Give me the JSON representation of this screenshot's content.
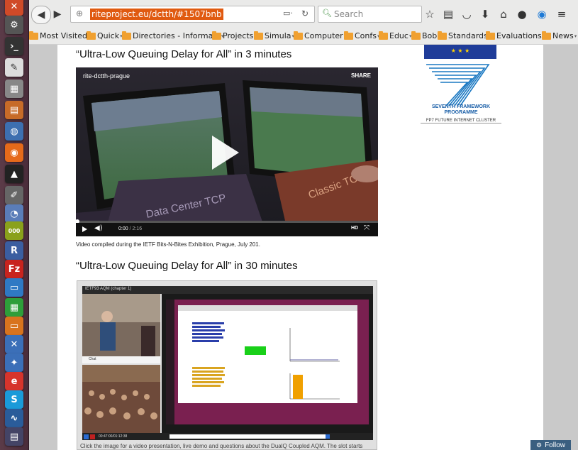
{
  "browser": {
    "url": "riteproject.eu/dctth/#1507bnb",
    "search_placeholder": "Search",
    "bookmarks": [
      {
        "label": "Most Visited",
        "arrow": "▾"
      },
      {
        "label": "Quick",
        "arrow": "▾"
      },
      {
        "label": "Directories - Informa...",
        "arrow": "▾"
      },
      {
        "label": "Projects",
        "arrow": "▾"
      },
      {
        "label": "Simula",
        "arrow": "▾"
      },
      {
        "label": "Computer",
        "arrow": "▾"
      },
      {
        "label": "Confs",
        "arrow": "▾"
      },
      {
        "label": "Educ",
        "arrow": "▾"
      },
      {
        "label": "Bob",
        "arrow": "▾"
      },
      {
        "label": "Standards",
        "arrow": "▾"
      },
      {
        "label": "Evaluations",
        "arrow": "▾"
      },
      {
        "label": "News",
        "arrow": "▾"
      }
    ]
  },
  "launcher": {
    "icons": [
      "dash-icon",
      "settings-icon",
      "terminal-icon",
      "text-editor-icon",
      "calculator-icon",
      "presentation-icon",
      "network-icon",
      "firefox-icon",
      "inkscape-icon",
      "paint-icon",
      "disk-icon",
      "calculator-green-icon",
      "rstudio-icon",
      "filezilla-icon",
      "document-icon",
      "spreadsheet-icon",
      "impress-icon",
      "network-tools-icon",
      "chat-icon",
      "email-icon",
      "skype-icon",
      "monitor-icon",
      "workspace-icon"
    ]
  },
  "page": {
    "section1_title": "“Ultra-Low Queuing Delay for All” in 3 minutes",
    "video1": {
      "channel": "rite-dctth-prague",
      "share": "SHARE",
      "time": "0:00",
      "duration": "/ 2:16",
      "hd": "HD",
      "progress": 0.0
    },
    "video1_caption": "Video compiled during the IETF Bits-N-Bites Exhibition, Prague, July 201.",
    "section2_title": "“Ultra-Low Queuing Delay for All” in 30 minutes",
    "video2": {
      "header": "IETF93 AQM (chapter 1)",
      "chat": "Chat",
      "timestamp": "00:47:00/01:12:38"
    },
    "video2_caption": "Click the image for a video presentation, live demo and questions about the DualQ Coupled AQM. The slot starts",
    "logos": {
      "fp7_line1": "SEVENTH FRAMEWORK",
      "fp7_line2": "PROGRAMME",
      "fp7_cluster": "FP7 FUTURE INTERNET CLUSTER"
    },
    "follow_label": "Follow"
  },
  "colors": {
    "accent": "#e05a10",
    "launcher": "#4a2c3a",
    "eu_blue": "#1f3c99",
    "fp7_blue": "#1a78c2"
  }
}
